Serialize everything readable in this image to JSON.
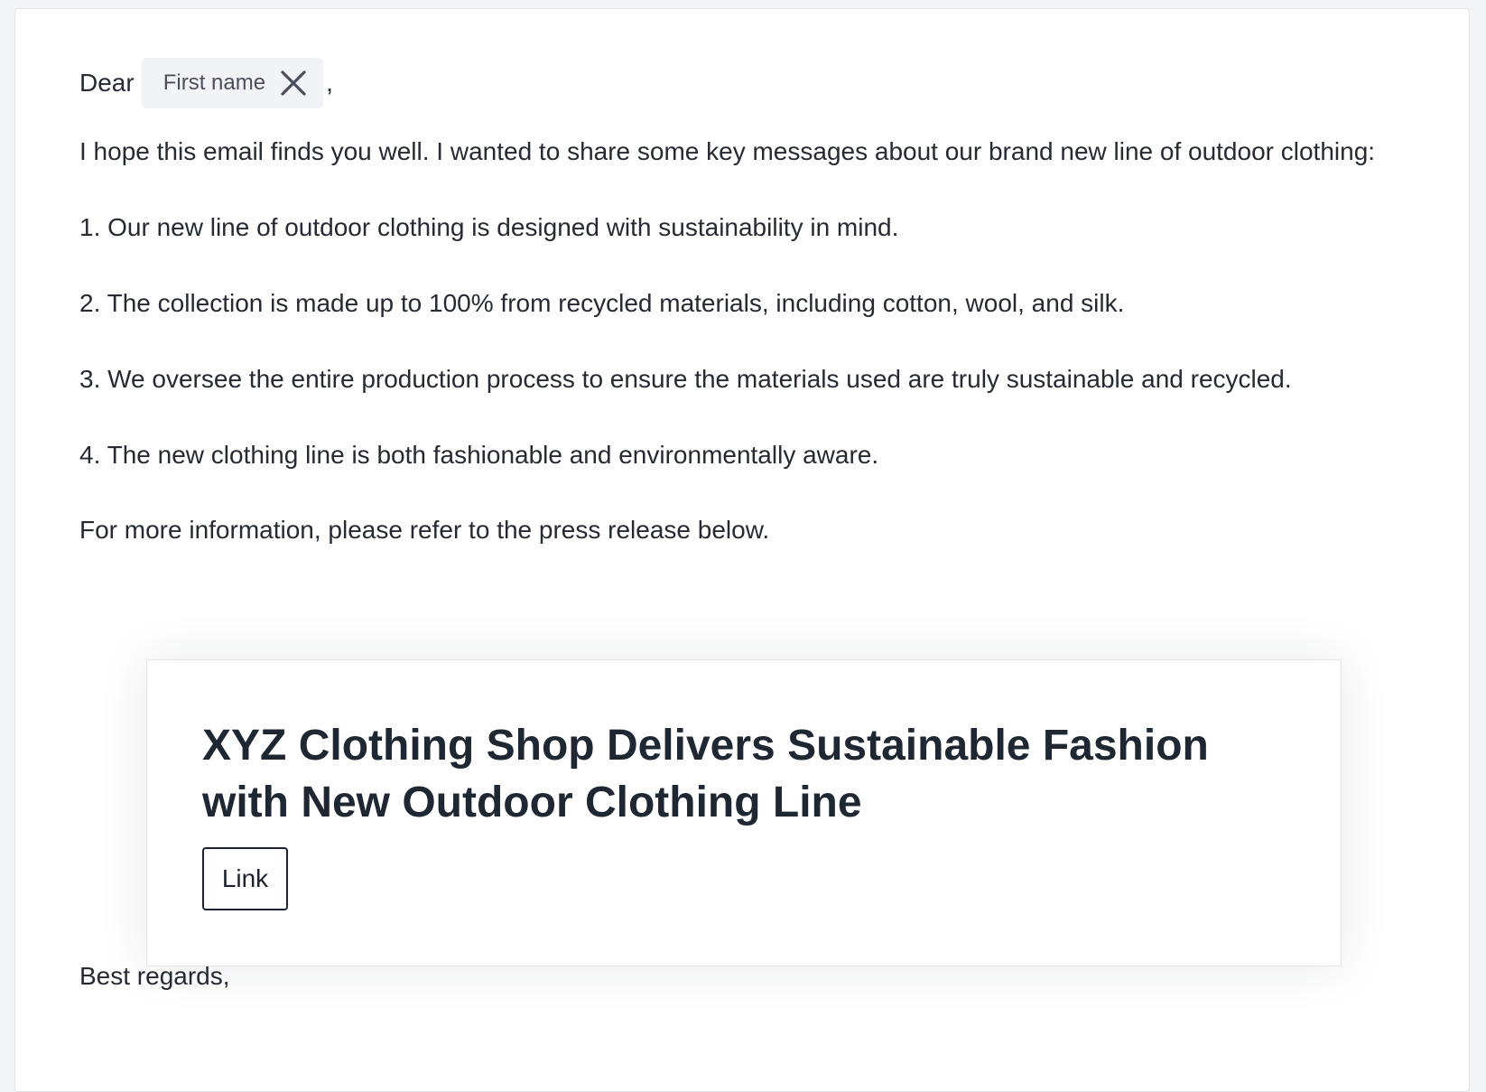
{
  "email": {
    "greeting_prefix": "Dear",
    "merge_tag_label": "First name",
    "merge_tag_remove_icon": "close-icon",
    "greeting_suffix": ",",
    "intro": "I hope this email finds you well. I wanted to share some key messages about our brand new line of outdoor clothing:",
    "points": [
      "1. Our new line of outdoor clothing is designed with sustainability in mind.",
      "2. The collection is made up to 100% from recycled materials, including cotton, wool, and silk.",
      "3. We oversee the entire production process to ensure the materials used are truly sustainable and recycled.",
      "4. The new clothing line is both fashionable and environmentally aware."
    ],
    "outro": "For more information, please refer to the press release below.",
    "signoff": "Best regards,"
  },
  "press_card": {
    "title": "XYZ Clothing Shop Delivers Sustainable Fashion with New Outdoor Clothing Line",
    "link_label": "Link"
  },
  "colors": {
    "text": "#262a33",
    "chip_bg": "#f2f3f6",
    "card_border": "#e3e5ea"
  }
}
